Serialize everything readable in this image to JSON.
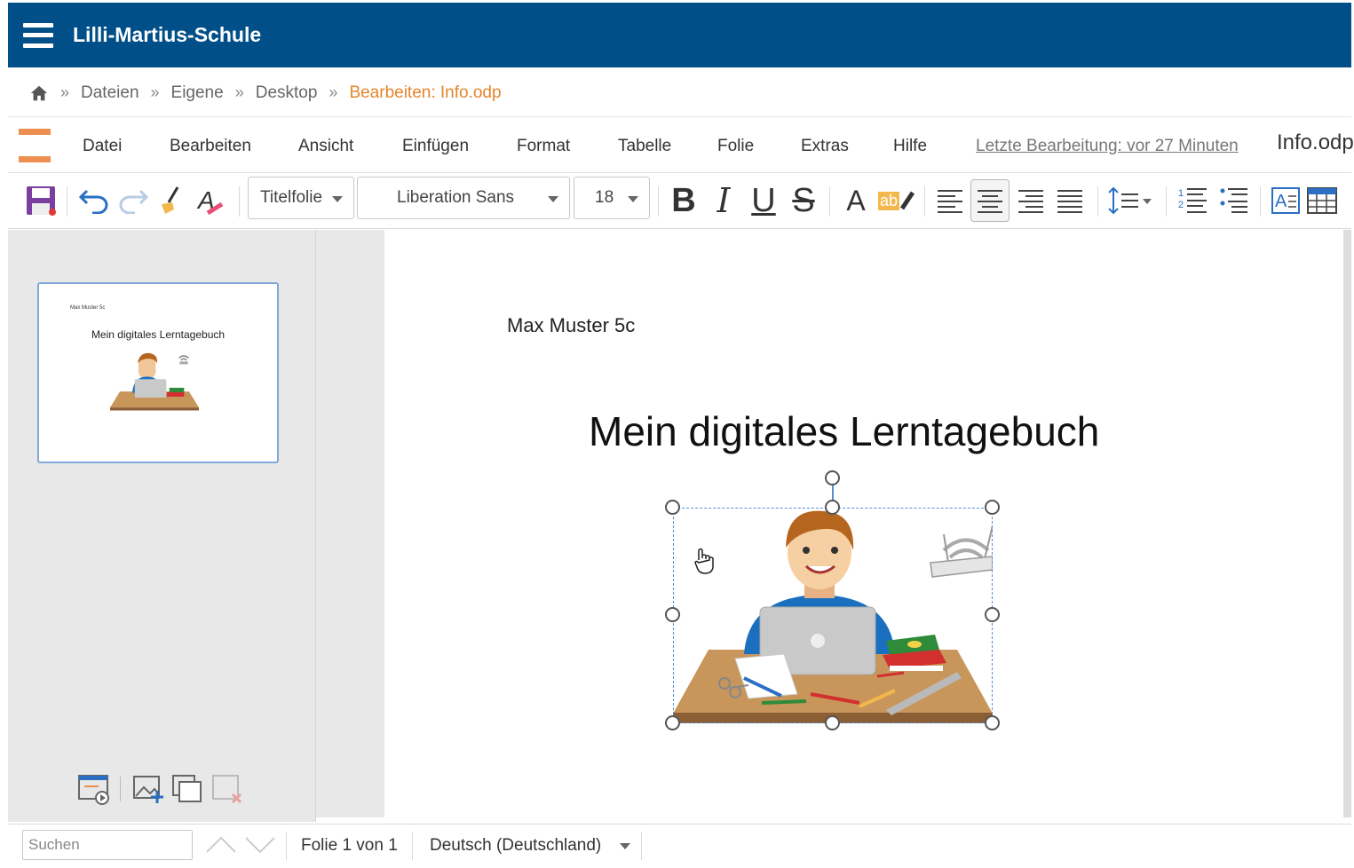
{
  "header": {
    "title": "Lilli-Martius-Schule"
  },
  "breadcrumb": {
    "separator": "»",
    "items": [
      "Dateien",
      "Eigene",
      "Desktop"
    ],
    "current": "Bearbeiten: Info.odp"
  },
  "menu": {
    "items": [
      "Datei",
      "Bearbeiten",
      "Ansicht",
      "Einfügen",
      "Format",
      "Tabelle",
      "Folie",
      "Extras",
      "Hilfe"
    ],
    "last_edit": "Letzte Bearbeitung: vor 27 Minuten",
    "document_name": "Info.odp"
  },
  "toolbar": {
    "layout": "Titelfolie",
    "font_name": "Liberation Sans",
    "font_size": "18",
    "bold": "B",
    "italic": "I",
    "underline": "U",
    "strike": "S",
    "font_color": "A",
    "highlight": "ab"
  },
  "thumbnail": {
    "subtitle": "Max Muster 5c",
    "title": "Mein digitales Lerntagebuch"
  },
  "slide": {
    "subtitle": "Max Muster 5c",
    "title": "Mein digitales Lerntagebuch"
  },
  "statusbar": {
    "search_placeholder": "Suchen",
    "slide_info": "Folie 1 von 1",
    "language": "Deutsch (Deutschland)"
  },
  "colors": {
    "header_bg": "#004f88",
    "accent_orange": "#e4852b",
    "logo_orange": "#ed8f50",
    "selection_blue": "#5b8fd0"
  }
}
